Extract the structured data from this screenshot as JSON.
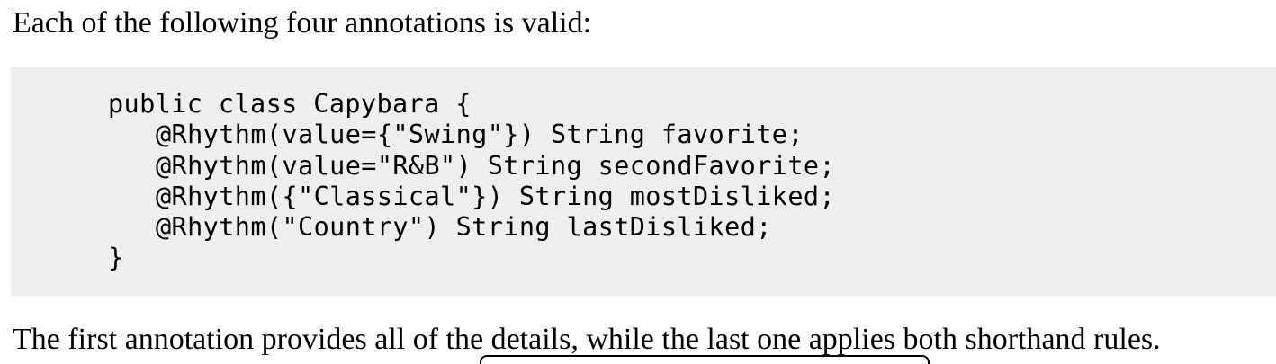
{
  "intro_text": "Each of the following four annotations is valid:",
  "code": {
    "lines": [
      "public class Capybara {",
      "@Rhythm(value={\"Swing\"}) String favorite;",
      "@Rhythm(value=\"R&B\") String secondFavorite;",
      "@Rhythm({\"Classical\"}) String mostDisliked;",
      "@Rhythm(\"Country\") String lastDisliked;",
      "}"
    ]
  },
  "outro_text": "The first annotation provides all of the details, while the last one applies both shorthand rules."
}
